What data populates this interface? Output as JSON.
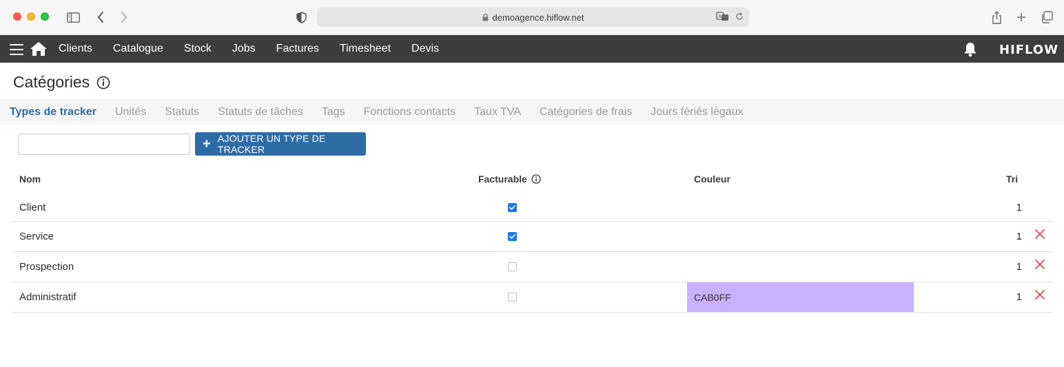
{
  "browser": {
    "url": "demoagence.hiflow.net"
  },
  "nav": {
    "items": [
      "Clients",
      "Catalogue",
      "Stock",
      "Jobs",
      "Factures",
      "Timesheet",
      "Devis"
    ],
    "logo": "HIFLOW"
  },
  "page": {
    "title": "Catégories"
  },
  "tabs": [
    "Types de tracker",
    "Unités",
    "Statuts",
    "Statuts de tâches",
    "Tags",
    "Fonctions contacts",
    "Taux TVA",
    "Catégories de frais",
    "Jours fériés légaux"
  ],
  "active_tab": "Types de tracker",
  "toolbar": {
    "search_value": "",
    "add_label": "AJOUTER UN TYPE DE TRACKER"
  },
  "table": {
    "headers": {
      "name": "Nom",
      "billable": "Facturable",
      "color": "Couleur",
      "sort": "Tri"
    },
    "rows": [
      {
        "name": "Client",
        "billable": true,
        "color": "",
        "color_hex": "",
        "sort": "1",
        "deletable": false
      },
      {
        "name": "Service",
        "billable": true,
        "color": "",
        "color_hex": "",
        "sort": "1",
        "deletable": true
      },
      {
        "name": "Prospection",
        "billable": false,
        "color": "",
        "color_hex": "",
        "sort": "1",
        "deletable": true
      },
      {
        "name": "Administratif",
        "billable": false,
        "color": "CAB0FF",
        "color_hex": "#CAB0FF",
        "sort": "1",
        "deletable": true
      }
    ]
  },
  "colors": {
    "nav_bg": "#3d3d3d",
    "accent": "#2e6ca6",
    "active_tab": "#2d6ca8",
    "delete": "#e04848",
    "checkbox": "#1877f2"
  }
}
